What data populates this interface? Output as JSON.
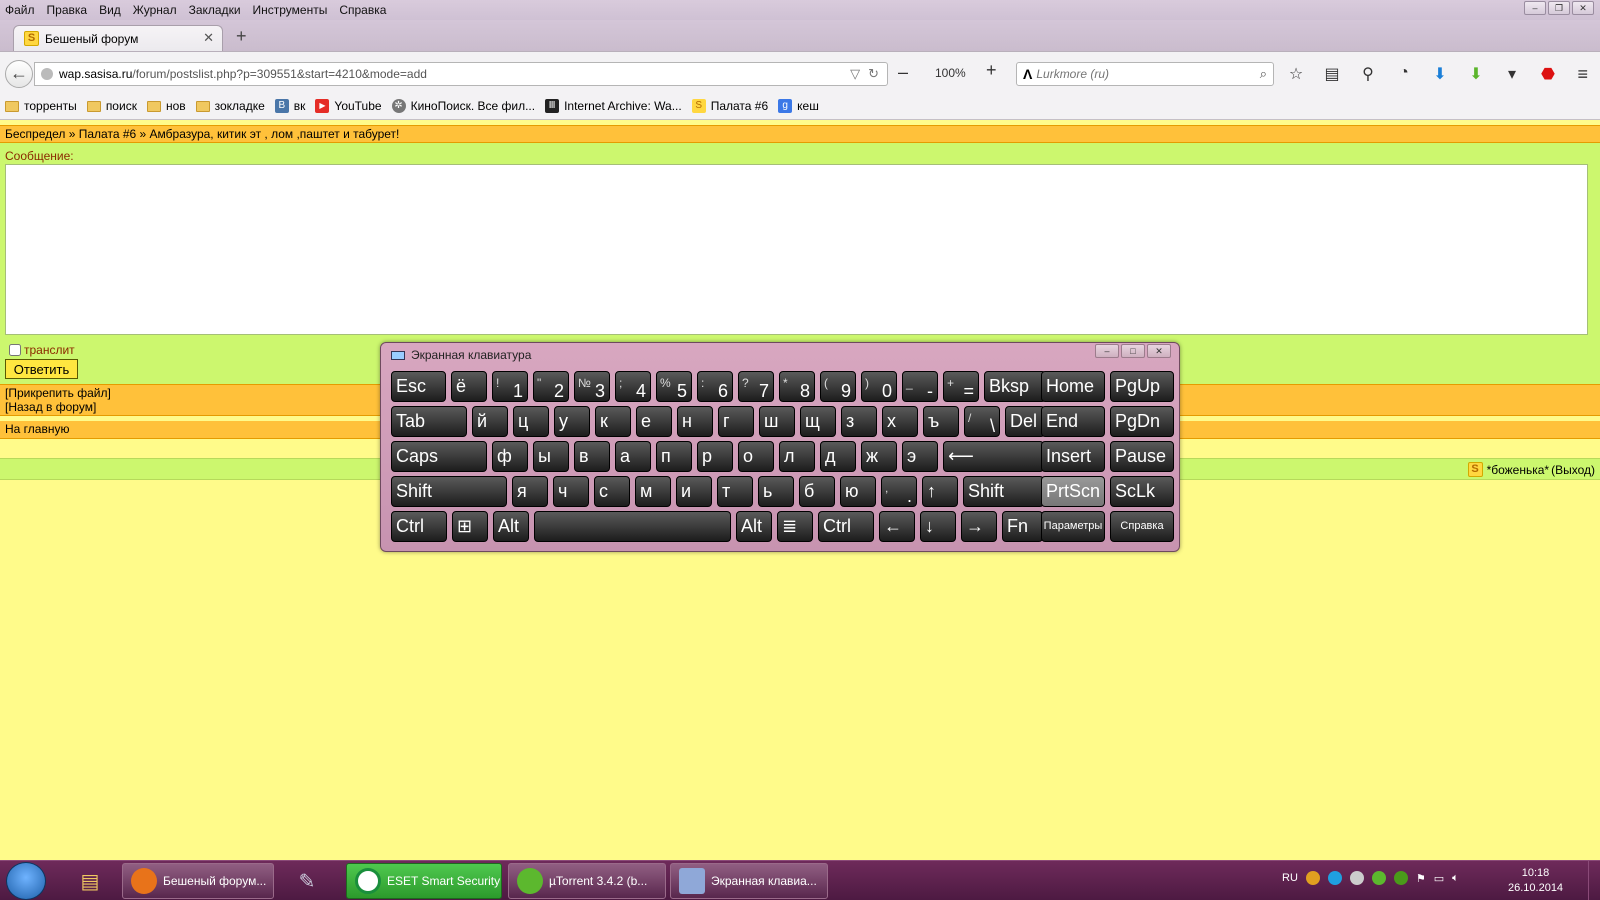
{
  "menu": [
    "Файл",
    "Правка",
    "Вид",
    "Журнал",
    "Закладки",
    "Инструменты",
    "Справка"
  ],
  "tab": {
    "title": "Бешеный форум",
    "favicon": "S"
  },
  "address": {
    "domain": "wap.sasisa.ru",
    "path": "/forum/postslist.php?p=309551&start=4210&mode=add"
  },
  "zoom": "100%",
  "search": {
    "engine_logo": "Λ",
    "placeholder": "Lurkmore (ru)"
  },
  "bookmarks": [
    {
      "label": "торренты",
      "icon": "folder-icon"
    },
    {
      "label": "поиск",
      "icon": "folder-icon"
    },
    {
      "label": "нов",
      "icon": "folder-icon"
    },
    {
      "label": "зокладке",
      "icon": "folder-icon"
    },
    {
      "label": "вк",
      "icon": "vk-icon",
      "badge": "B"
    },
    {
      "label": "YouTube",
      "icon": "youtube-icon",
      "badge": "▶"
    },
    {
      "label": "КиноПоиск. Все фил...",
      "icon": "film-reel-icon",
      "badge": "✲"
    },
    {
      "label": "Internet Archive: Wa...",
      "icon": "archive-icon",
      "badge": "Ⅲ"
    },
    {
      "label": "Палата #6",
      "icon": "sasisa-icon",
      "badge": "S"
    },
    {
      "label": "кеш",
      "icon": "google-icon",
      "badge": "g"
    }
  ],
  "forum": {
    "breadcrumb": "Беспредел » Палата #6 » Амбразура, китик эт , лом ,паштет и табурет!",
    "message_label": "Сообщение:",
    "translit_label": "транслит",
    "reply_button": "Ответить",
    "attach_link": "[Прикрепить файл]",
    "back_link": "[Назад в форум]",
    "home_link": "На главную",
    "user_name": "*боженька*",
    "logout_link": "(Выход)"
  },
  "osk": {
    "title": "Экранная клавиатура",
    "rows": [
      [
        {
          "main": "Esc",
          "w": 55
        },
        {
          "main": "ё",
          "w": 36
        },
        {
          "sup": "!",
          "sub": "1",
          "w": 36
        },
        {
          "sup": "\"",
          "sub": "2",
          "w": 36
        },
        {
          "sup": "№",
          "sub": "3",
          "w": 36
        },
        {
          "sup": ";",
          "sub": "4",
          "w": 36
        },
        {
          "sup": "%",
          "sub": "5",
          "w": 36
        },
        {
          "sup": ":",
          "sub": "6",
          "w": 36
        },
        {
          "sup": "?",
          "sub": "7",
          "w": 36
        },
        {
          "sup": "*",
          "sub": "8",
          "w": 36
        },
        {
          "sup": "(",
          "sub": "9",
          "w": 36
        },
        {
          "sup": ")",
          "sub": "0",
          "w": 36
        },
        {
          "sup": "_",
          "sub": "-",
          "w": 36
        },
        {
          "sup": "+",
          "sub": "=",
          "w": 36
        },
        {
          "main": "Bksp",
          "w": 62
        }
      ],
      [
        {
          "main": "Tab",
          "w": 76
        },
        {
          "main": "й",
          "w": 36
        },
        {
          "main": "ц",
          "w": 36
        },
        {
          "main": "у",
          "w": 36
        },
        {
          "main": "к",
          "w": 36
        },
        {
          "main": "е",
          "w": 36
        },
        {
          "main": "н",
          "w": 36
        },
        {
          "main": "г",
          "w": 36
        },
        {
          "main": "ш",
          "w": 36
        },
        {
          "main": "щ",
          "w": 36
        },
        {
          "main": "з",
          "w": 36
        },
        {
          "main": "х",
          "w": 36
        },
        {
          "main": "ъ",
          "w": 36
        },
        {
          "sup": "/",
          "sub": "\\",
          "w": 36
        },
        {
          "main": "Del",
          "w": 40
        }
      ],
      [
        {
          "main": "Caps",
          "w": 96
        },
        {
          "main": "ф",
          "w": 36
        },
        {
          "main": "ы",
          "w": 36
        },
        {
          "main": "в",
          "w": 36
        },
        {
          "main": "а",
          "w": 36
        },
        {
          "main": "п",
          "w": 36
        },
        {
          "main": "р",
          "w": 36
        },
        {
          "main": "о",
          "w": 36
        },
        {
          "main": "л",
          "w": 36
        },
        {
          "main": "д",
          "w": 36
        },
        {
          "main": "ж",
          "w": 36
        },
        {
          "main": "э",
          "w": 36
        },
        {
          "main": "⟵",
          "w": 101
        }
      ],
      [
        {
          "main": "Shift",
          "w": 116
        },
        {
          "main": "я",
          "w": 36
        },
        {
          "main": "ч",
          "w": 36
        },
        {
          "main": "с",
          "w": 36
        },
        {
          "main": "м",
          "w": 36
        },
        {
          "main": "и",
          "w": 36
        },
        {
          "main": "т",
          "w": 36
        },
        {
          "main": "ь",
          "w": 36
        },
        {
          "main": "б",
          "w": 36
        },
        {
          "main": "ю",
          "w": 36
        },
        {
          "sup": ",",
          "sub": ".",
          "w": 36
        },
        {
          "main": "↑",
          "w": 36
        },
        {
          "main": "Shift",
          "w": 81
        }
      ],
      [
        {
          "main": "Ctrl",
          "w": 56
        },
        {
          "main": "⊞",
          "w": 36
        },
        {
          "main": "Alt",
          "w": 36
        },
        {
          "main": "",
          "w": 197
        },
        {
          "main": "Alt",
          "w": 36
        },
        {
          "main": "≣",
          "w": 36
        },
        {
          "main": "Ctrl",
          "w": 56
        },
        {
          "main": "←",
          "w": 36
        },
        {
          "main": "↓",
          "w": 36
        },
        {
          "main": "→",
          "w": 36
        },
        {
          "main": "Fn",
          "w": 41
        }
      ]
    ],
    "side": [
      [
        {
          "main": "Home",
          "w": 64
        },
        {
          "main": "PgUp",
          "w": 64
        }
      ],
      [
        {
          "main": "End",
          "w": 64
        },
        {
          "main": "PgDn",
          "w": 64
        }
      ],
      [
        {
          "main": "Insert",
          "w": 64
        },
        {
          "main": "Pause",
          "w": 64
        }
      ],
      [
        {
          "main": "PrtScn",
          "w": 64,
          "lit": true
        },
        {
          "main": "ScLk",
          "w": 64
        }
      ],
      [
        {
          "main": "Параметры",
          "w": 64,
          "small": true
        },
        {
          "main": "Справка",
          "w": 64,
          "small": true
        }
      ]
    ]
  },
  "taskbar": {
    "buttons": [
      {
        "label": "Бешеный форум...",
        "color": "#e8731a"
      },
      {
        "label": "ESET Smart Security",
        "color": "#1a8f3c",
        "green": true
      },
      {
        "label": "µTorrent 3.4.2 (b...",
        "color": "#5cb82e"
      },
      {
        "label": "Экранная клавиа...",
        "color": "#8fa8d8"
      }
    ],
    "lang": "RU",
    "time": "10:18",
    "date": "26.10.2014"
  },
  "colors": {
    "breadcrumb_bg": "#FFC13A",
    "green_bg": "#CCF76E",
    "page_bg": "#FFFB8A"
  }
}
